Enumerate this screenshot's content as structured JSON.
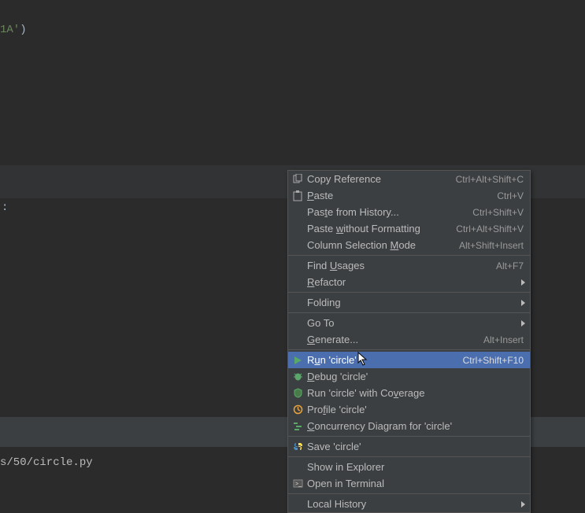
{
  "code": {
    "fragment_string": "1A'",
    "fragment_paren": ")"
  },
  "console": {
    "path": "s/50/circle.py"
  },
  "punct": {
    "colon": ":"
  },
  "menu": {
    "copy_reference": "Copy Reference",
    "copy_reference_sc": "Ctrl+Alt+Shift+C",
    "paste_pre": "",
    "paste_u": "P",
    "paste_post": "aste",
    "paste_sc": "Ctrl+V",
    "paste_history_pre": "Pas",
    "paste_history_u": "t",
    "paste_history_post": "e from History...",
    "paste_history_sc": "Ctrl+Shift+V",
    "paste_plain_pre": "Paste ",
    "paste_plain_u": "w",
    "paste_plain_post": "ithout Formatting",
    "paste_plain_sc": "Ctrl+Alt+Shift+V",
    "column_mode_pre": "Column Selection ",
    "column_mode_u": "M",
    "column_mode_post": "ode",
    "column_mode_sc": "Alt+Shift+Insert",
    "find_usages_pre": "Find ",
    "find_usages_u": "U",
    "find_usages_post": "sages",
    "find_usages_sc": "Alt+F7",
    "refactor_pre": "",
    "refactor_u": "R",
    "refactor_post": "efactor",
    "folding": "Folding",
    "goto": "Go To",
    "generate_pre": "",
    "generate_u": "G",
    "generate_post": "enerate...",
    "generate_sc": "Alt+Insert",
    "run_pre": "R",
    "run_u": "u",
    "run_post": "n 'circle'",
    "run_sc": "Ctrl+Shift+F10",
    "debug_pre": "",
    "debug_u": "D",
    "debug_post": "ebug 'circle'",
    "coverage_pre": "Run 'circle' with Co",
    "coverage_u": "v",
    "coverage_post": "erage",
    "profile_pre": "Pro",
    "profile_u": "f",
    "profile_post": "ile 'circle'",
    "concurrency_pre": "",
    "concurrency_u": "C",
    "concurrency_post": "oncurrency Diagram for 'circle'",
    "save": "Save 'circle'",
    "show_explorer": "Show in Explorer",
    "open_terminal": "Open in Terminal",
    "local_history": "Local History"
  }
}
